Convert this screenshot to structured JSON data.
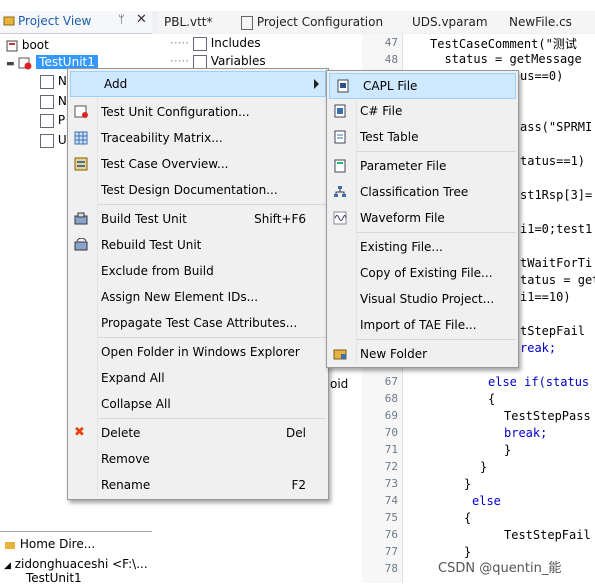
{
  "project_view": {
    "title": "Project View",
    "pin": "ᛘ",
    "close": "✕",
    "tree": [
      "boot",
      "TestUnit1",
      "N",
      "N",
      "P",
      "U"
    ],
    "bottom_panel_title": "Home Dire...",
    "bottom_panel_item": "zidonghuaceshi <F:\\...",
    "bottom_panel_item2": "TestUnit1"
  },
  "tabs": [
    "PBL.vtt*",
    "Project Configuration",
    "UDS.vparam",
    "NewFile.cs"
  ],
  "mid_tree": {
    "items": [
      "Includes",
      "Variables"
    ],
    "partial_text": "oid"
  },
  "context_menu": {
    "items": [
      {
        "label": "Add",
        "shortcut": ""
      },
      {
        "label": "Test Unit Configuration...",
        "shortcut": ""
      },
      {
        "label": "Traceability Matrix...",
        "shortcut": ""
      },
      {
        "label": "Test Case Overview...",
        "shortcut": ""
      },
      {
        "label": "Test Design Documentation...",
        "shortcut": ""
      },
      {
        "label": "Build Test Unit",
        "shortcut": "Shift+F6"
      },
      {
        "label": "Rebuild Test Unit",
        "shortcut": ""
      },
      {
        "label": "Exclude from Build",
        "shortcut": ""
      },
      {
        "label": "Assign New Element IDs...",
        "shortcut": ""
      },
      {
        "label": "Propagate Test Case Attributes...",
        "shortcut": ""
      },
      {
        "label": "Open Folder in Windows Explorer",
        "shortcut": ""
      },
      {
        "label": "Expand All",
        "shortcut": ""
      },
      {
        "label": "Collapse All",
        "shortcut": ""
      },
      {
        "label": "Delete",
        "shortcut": "Del"
      },
      {
        "label": "Remove",
        "shortcut": ""
      },
      {
        "label": "Rename",
        "shortcut": "F2"
      }
    ]
  },
  "submenu": {
    "items": [
      "CAPL File",
      "C# File",
      "Test Table",
      "Parameter File",
      "Classification Tree",
      "Waveform File",
      "Existing File...",
      "Copy of Existing File...",
      "Visual Studio Project...",
      "Import of TAE File...",
      "New Folder"
    ]
  },
  "code": {
    "line_numbers": [
      "47",
      "48",
      "",
      "",
      "",
      "",
      "",
      "",
      "",
      "",
      "",
      "",
      "",
      "",
      "",
      "",
      "",
      "67",
      "68",
      "69",
      "70",
      "71",
      "72",
      "73",
      "74",
      "75",
      "76",
      "77",
      "78"
    ],
    "lines": [
      "TestCaseComment(\"测试",
      "  status = getMessage",
      "us==0)",
      "ass(\"SPRMI",
      "tatus==1)",
      "st1Rsp[3]=",
      "i1=0;test1",
      "tWaitForTi",
      "tatus = get",
      "i1==10)",
      "tStepFail",
      "reak;",
      "else if(status",
      "{",
      "TestStepPass",
      "break;",
      "}",
      "}",
      "}",
      "else",
      "{",
      "TestStepFail",
      "}"
    ]
  },
  "watermark": "CSDN @quentin_能",
  "colors": {
    "selection": "#3399ff",
    "menu_bg": "#f0f0f0",
    "menu_hover": "#cde8ff",
    "keyword": "#0000cc",
    "string": "#a31515"
  }
}
